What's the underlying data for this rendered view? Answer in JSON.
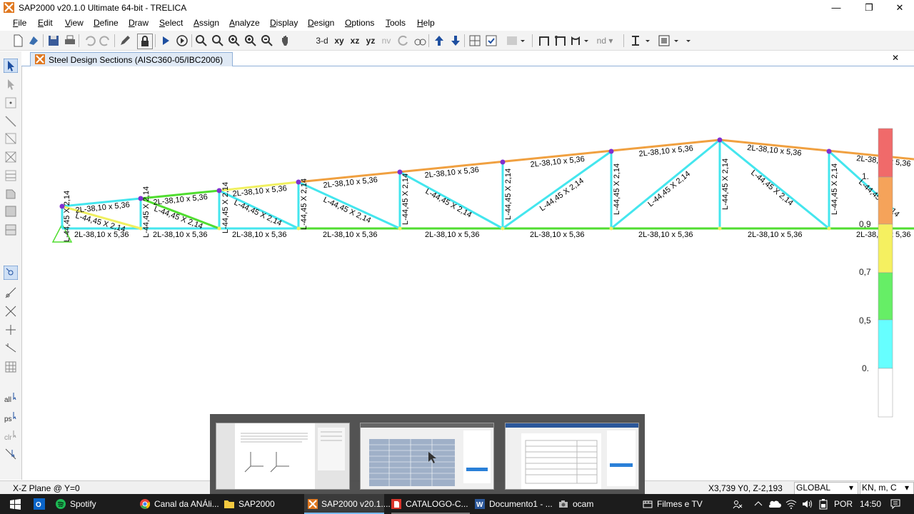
{
  "window": {
    "title": "SAP2000 v20.1.0 Ultimate 64-bit - TRELICA",
    "minimize": "—",
    "restore": "❐",
    "close": "✕"
  },
  "menu": [
    "File",
    "Edit",
    "View",
    "Define",
    "Draw",
    "Select",
    "Assign",
    "Analyze",
    "Display",
    "Design",
    "Options",
    "Tools",
    "Help"
  ],
  "toolbar": {
    "view_3d": "3-d",
    "view_xy": "xy",
    "view_xz": "xz",
    "view_yz": "yz",
    "view_nv": "nv",
    "nd": "nd"
  },
  "tab": {
    "title": "Steel Design Sections  (AISC360-05/IBC2006)",
    "close": "✕"
  },
  "labels": {
    "top_chord": "2L-38,10 x 5,36",
    "bottom_chord": "2L-38,10 x 5,36",
    "vertical": "L-44,45 X 2,14",
    "diagonal": "L-44,45 X 2,14"
  },
  "legend": {
    "ticks": [
      "1.",
      "0,9",
      "0,7",
      "0,5",
      "0."
    ],
    "colors": [
      "#f06a6a",
      "#f5a35a",
      "#f5f060",
      "#66ee66",
      "#66ffff",
      "#ffffff"
    ]
  },
  "status": {
    "plane": "X-Z Plane @ Y=0",
    "coords": "X3,739  Y0,  Z-2,193",
    "coord_system": "GLOBAL",
    "units": "KN, m, C"
  },
  "taskbar": {
    "items": [
      {
        "label": "Spotify",
        "icon": "spotify-icon",
        "color": "#1db954"
      },
      {
        "label": "Canal da ANÁli...",
        "icon": "chrome-icon",
        "color": "#e8453c"
      },
      {
        "label": "SAP2000",
        "icon": "folder-icon",
        "color": "#f3c940"
      },
      {
        "label": "SAP2000 v20.1....",
        "icon": "sap-icon",
        "color": "#e07820"
      },
      {
        "label": "CATALOGO-C...",
        "icon": "pdf-icon",
        "color": "#d9342b"
      },
      {
        "label": "Documento1 - ...",
        "icon": "word-icon",
        "color": "#2b579a"
      },
      {
        "label": "ocam",
        "icon": "camera-icon",
        "color": "#bbbbbb"
      },
      {
        "label": "Filmes e TV",
        "icon": "film-icon",
        "color": "#ffffff"
      }
    ],
    "language": "POR",
    "time": "14:50"
  },
  "colors": {
    "member_cyan": "#44e6ee",
    "member_orange": "#f0a040",
    "member_green": "#50dd30",
    "member_yellow": "#f0f060",
    "joint_purple": "#8030d0"
  }
}
